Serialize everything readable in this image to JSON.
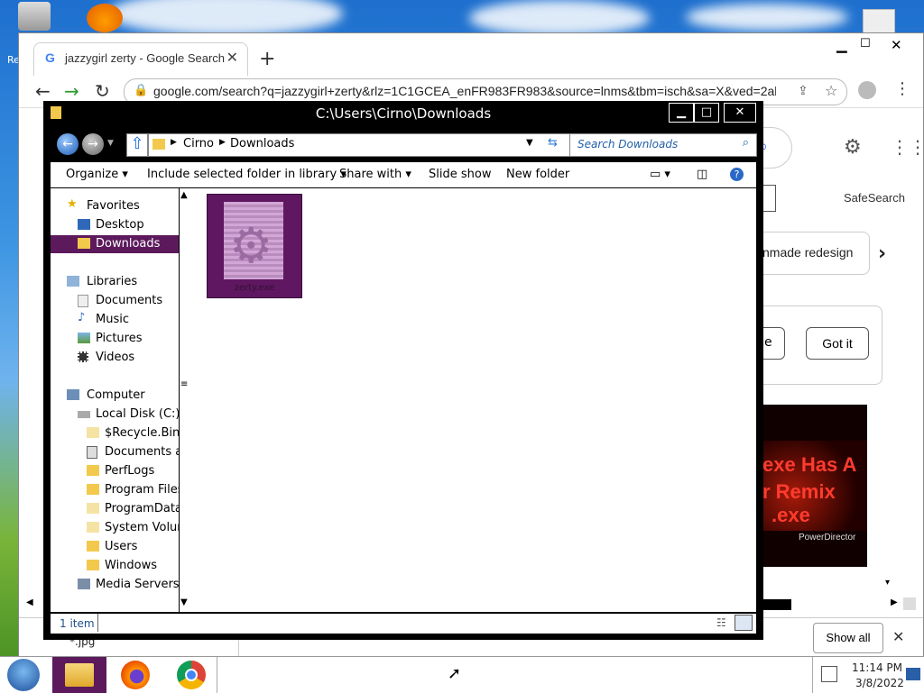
{
  "browser": {
    "tab_title": "jazzygirl zerty - Google Search",
    "url": "google.com/search?q=jazzygirl+zerty&rlz=1C1GCEA_enFR983FR983&source=lnms&tbm=isch&sa=X&ved=2ah...",
    "page": {
      "safesearch": "SafeSearch",
      "chip_label": "nmade redesign",
      "got_it": "Got it",
      "partial_button": "e",
      "thumb_text_1": "exe Has A",
      "thumb_text_2": "r Remix",
      "thumb_text_3": ".exe",
      "thumb_watermark": "PowerDirector",
      "show_all": "Show all",
      "download_file": "*.jpg"
    }
  },
  "explorer": {
    "title": "C:\\Users\\Cirno\\Downloads",
    "breadcrumb": [
      "Cirno",
      "Downloads"
    ],
    "search_placeholder": "Search Downloads",
    "commands": {
      "organize": "Organize",
      "include": "Include selected folder in library",
      "share": "Share with",
      "slideshow": "Slide show",
      "newfolder": "New folder"
    },
    "nav": {
      "favorites": "Favorites",
      "desktop": "Desktop",
      "downloads": "Downloads",
      "libraries": "Libraries",
      "documents": "Documents",
      "music": "Music",
      "pictures": "Pictures",
      "videos": "Videos",
      "computer": "Computer",
      "localdisk": "Local Disk (C:)",
      "folders": [
        "$Recycle.Bin",
        "Documents and",
        "PerfLogs",
        "Program Files",
        "ProgramData",
        "System Volume",
        "Users",
        "Windows"
      ],
      "mediaservers": "Media Servers"
    },
    "file_label": "zerty.exe",
    "status": "1 item"
  },
  "taskbar": {
    "time": "11:14 PM",
    "date": "3/8/2022"
  },
  "colors": {
    "selection": "#5c1a5c",
    "file_tile": "#5e1760"
  }
}
